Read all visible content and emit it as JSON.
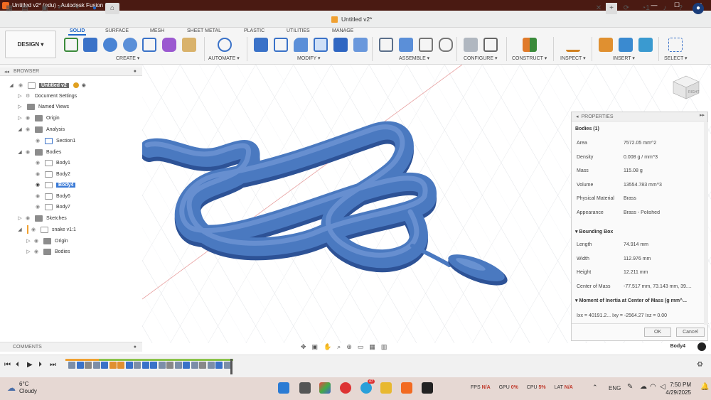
{
  "window": {
    "title": "Untitled v2* (edu) - Autodesk Fusion",
    "min": "—",
    "max": "☐",
    "close": "✕"
  },
  "document_tab": {
    "title": "Untitled v2*",
    "close": "✕"
  },
  "header_right": {
    "jobs_count": "1"
  },
  "workspace": {
    "label": "DESIGN ▾"
  },
  "ribbon_tabs": [
    "SOLID",
    "SURFACE",
    "MESH",
    "SHEET METAL",
    "PLASTIC",
    "UTILITIES",
    "MANAGE"
  ],
  "ribbon_groups": [
    "CREATE ▾",
    "AUTOMATE ▾",
    "MODIFY ▾",
    "ASSEMBLE ▾",
    "CONFIGURE ▾",
    "CONSTRUCT ▾",
    "INSPECT ▾",
    "INSERT ▾",
    "SELECT ▾"
  ],
  "browser": {
    "title": "BROWSER",
    "root": "Untitled v2",
    "document_settings": "Document Settings",
    "named_views": "Named Views",
    "origin": "Origin",
    "analysis": "Analysis",
    "section": "Section1",
    "bodies": "Bodies",
    "body1": "Body1",
    "body2": "Body2",
    "body4": "Body4",
    "body6": "Body6",
    "body7": "Body7",
    "sketches": "Sketches",
    "component": "snake v1:1",
    "comp_origin": "Origin",
    "comp_bodies": "Bodies"
  },
  "properties": {
    "title": "PROPERTIES",
    "selection": "Bodies (1)",
    "rows": [
      {
        "k": "Area",
        "v": "7572.05 mm^2"
      },
      {
        "k": "Density",
        "v": "0.008 g / mm^3"
      },
      {
        "k": "Mass",
        "v": "115.08 g"
      },
      {
        "k": "Volume",
        "v": "13554.783 mm^3"
      },
      {
        "k": "Physical Material",
        "v": "Brass"
      },
      {
        "k": "Appearance",
        "v": "Brass - Polished"
      }
    ],
    "bbox_title": "Bounding Box",
    "bbox_rows": [
      {
        "k": "Length",
        "v": "74.914 mm"
      },
      {
        "k": "Width",
        "v": "112.976 mm"
      },
      {
        "k": "Height",
        "v": "12.211 mm"
      },
      {
        "k": "Center of Mass",
        "v": "-77.517 mm, 73.143 mm, 39...."
      }
    ],
    "moi_title": "Moment of Inertia at Center of Mass   (g mm^...",
    "moi_values": "Ixx = 40191.2...   Ixy = -2564.27    Ixz = 0.00",
    "ok": "OK",
    "cancel": "Cancel"
  },
  "comments": "COMMENTS",
  "selected_body": "Body4",
  "viewcube": {
    "face_label": "RIGHT"
  },
  "taskbar": {
    "temperature": "6°C",
    "condition": "Cloudy",
    "fps_label": "FPS",
    "fps": "N/A",
    "gpu_label": "GPU",
    "gpu": "0%",
    "cpu_label": "CPU",
    "cpu": "5%",
    "lat_label": "LAT",
    "lat": "N/A",
    "lang": "ENG",
    "time": "7:50 PM",
    "date": "4/29/2025",
    "badge": "47"
  },
  "colors": {
    "accent": "#1e66c8",
    "snake": "#4a79c0",
    "titlebar": "#4a1a12",
    "grid": "#c9ced6"
  }
}
